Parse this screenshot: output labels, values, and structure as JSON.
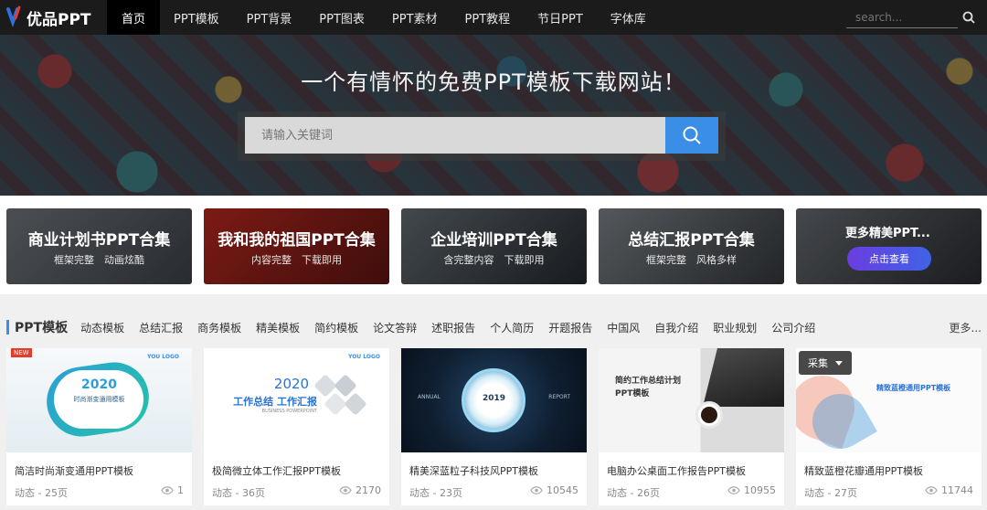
{
  "brand": {
    "logo_text": "优品PPT"
  },
  "nav": {
    "items": [
      "首页",
      "PPT模板",
      "PPT背景",
      "PPT图表",
      "PPT素材",
      "PPT教程",
      "节日PPT",
      "字体库"
    ],
    "search_placeholder": "search..."
  },
  "hero": {
    "title": "一个有情怀的免费PPT模板下载网站！",
    "search_placeholder": "请输入关键词"
  },
  "banners": [
    {
      "title": "商业计划书PPT合集",
      "sub": "框架完整　动画炫酷"
    },
    {
      "title": "我和我的祖国PPT合集",
      "sub": "内容完整　下载即用"
    },
    {
      "title": "企业培训PPT合集",
      "sub": "含完整内容　下载即用"
    },
    {
      "title": "总结汇报PPT合集",
      "sub": "框架完整　风格多样"
    }
  ],
  "more_banner": {
    "title": "更多精美PPT...",
    "button": "点击查看"
  },
  "category": {
    "title": "PPT模板",
    "items": [
      "动态模板",
      "总结汇报",
      "商务模板",
      "精美模板",
      "简约模板",
      "论文答辩",
      "述职报告",
      "个人简历",
      "开题报告",
      "中国风",
      "自我介绍",
      "职业规划",
      "公司介绍"
    ],
    "more": "更多..."
  },
  "cards": [
    {
      "title": "简洁时尚渐变通用PPT模板",
      "meta": "动态 - 25页",
      "views": "1",
      "badge": "NEW",
      "thumb_year": "2020",
      "thumb_sub": "时尚渐变通用模板",
      "thumb_logo": "YOU LOGO"
    },
    {
      "title": "极简微立体工作汇报PPT模板",
      "meta": "动态 - 36页",
      "views": "2170",
      "thumb_year": "2020",
      "thumb_sub": "工作总结 工作汇报",
      "thumb_en": "BUSINESS POWERPOINT",
      "thumb_logo": "YOU LOGO"
    },
    {
      "title": "精美深蓝粒子科技风PPT模板",
      "meta": "动态 - 23页",
      "views": "10545",
      "thumb_year": "2019",
      "thumb_left": "ANNUAL",
      "thumb_right": "REPORT"
    },
    {
      "title": "电脑办公桌面工作报告PPT模板",
      "meta": "动态 - 26页",
      "views": "10955",
      "thumb_sub": "简约工作总结计划",
      "thumb_sub2": "PPT模板"
    },
    {
      "title": "精致蓝橙花瓣通用PPT模板",
      "meta": "动态 - 27页",
      "views": "11744",
      "collect": "采集",
      "thumb_sub": "精致蓝橙通用PPT模板"
    }
  ],
  "colors": {
    "accent": "#3a8ee6",
    "nav_bg": "#1b1b1b"
  }
}
